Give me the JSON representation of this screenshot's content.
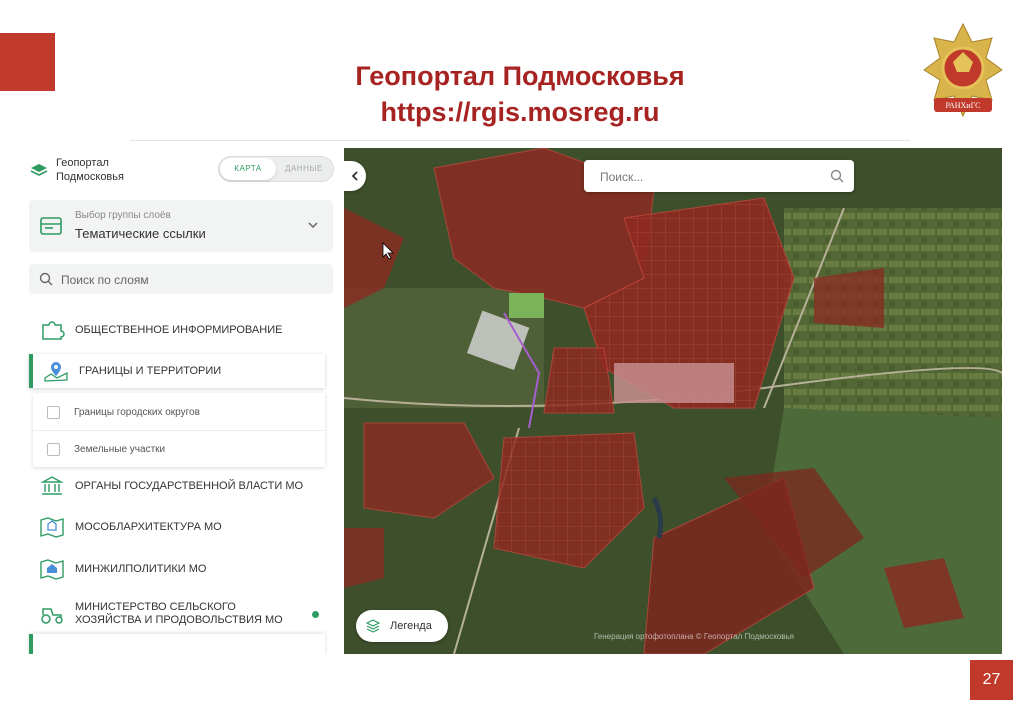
{
  "slide": {
    "title_line1": "Геопортал Подмосковья",
    "title_line2": "https://rgis.mosreg.ru",
    "emblem_text": "РАНХиГС",
    "page_number": "27",
    "accent_color": "#c0392b",
    "title_color": "#a62321"
  },
  "panel": {
    "logo_text": "Геопортал Подмосковья",
    "mode_toggle": {
      "map": "КАРТА",
      "data": "ДАННЫЕ"
    },
    "layer_group": {
      "caption": "Выбор группы слоёв",
      "value": "Тематические ссылки"
    },
    "layer_search": {
      "placeholder": "Поиск по слоям"
    },
    "categories": [
      {
        "label": "ОБЩЕСТВЕННОЕ ИНФОРМИРОВАНИЕ",
        "icon": "puzzle-icon"
      },
      {
        "label": "ГРАНИЦЫ И ТЕРРИТОРИИ",
        "icon": "map-pin-icon",
        "selected": true
      },
      {
        "label": "ОРГАНЫ ГОСУДАРСТВЕННОЙ ВЛАСТИ МО",
        "icon": "government-building-icon"
      },
      {
        "label": "МОСОБЛАРХИТЕКТУРА МО",
        "icon": "architecture-map-icon"
      },
      {
        "label": "МИНЖИЛПОЛИТИКИ МО",
        "icon": "housing-map-icon"
      },
      {
        "label": "МИНИСТЕРСТВО СЕЛЬСКОГО ХОЗЯЙСТВА И ПРОДОВОЛЬСТВИЯ МО",
        "icon": "tractor-icon"
      }
    ],
    "sublayers": [
      {
        "label": "Границы городских округов"
      },
      {
        "label": "Земельные участки"
      }
    ],
    "accent_color": "#2e9b63"
  },
  "map": {
    "search_placeholder": "Поиск...",
    "legend_label": "Легенда",
    "attribution": "Генерация ортофотоплана © Геопортал Подмосковья"
  }
}
